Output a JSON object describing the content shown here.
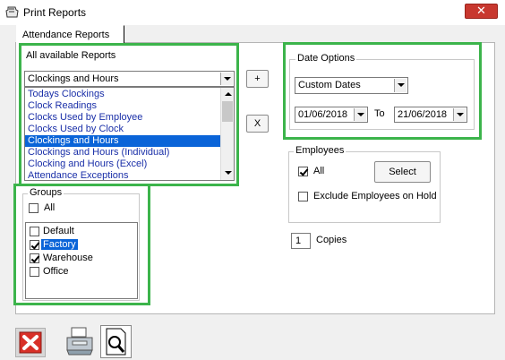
{
  "window": {
    "title": "Print Reports",
    "close_glyph": "✕"
  },
  "tabs": [
    {
      "label": "Attendance Reports"
    }
  ],
  "reports": {
    "label": "All available Reports",
    "selected": "Clockings and Hours",
    "items": [
      "Todays Clockings",
      "Clock Readings",
      "Clocks Used by Employee",
      "Clocks Used by Clock",
      "Clockings and Hours",
      "Clockings and Hours (Individual)",
      "Clocking and Hours (Excel)",
      "Attendance Exceptions"
    ],
    "selected_index": 4,
    "add_label": "+",
    "remove_label": "X"
  },
  "date_options": {
    "label": "Date Options",
    "range_type": "Custom Dates",
    "from": "01/06/2018",
    "to_label": "To",
    "to": "21/06/2018"
  },
  "employees": {
    "label": "Employees",
    "all_label": "All",
    "all_checked": true,
    "select_label": "Select",
    "exclude_label": "Exclude Employees on Hold",
    "exclude_checked": false
  },
  "copies": {
    "value": "1",
    "label": "Copies"
  },
  "groups": {
    "label": "Groups",
    "all_label": "All",
    "all_checked": false,
    "items": [
      {
        "label": "Default",
        "checked": false,
        "selected": false
      },
      {
        "label": "Factory",
        "checked": true,
        "selected": true
      },
      {
        "label": "Warehouse",
        "checked": true,
        "selected": false
      },
      {
        "label": "Office",
        "checked": false,
        "selected": false
      }
    ]
  },
  "toolbar": {
    "cancel_icon": "red-x-icon",
    "print_icon": "printer-icon",
    "preview_icon": "print-preview-icon"
  },
  "colors": {
    "highlight": "#3cb44b",
    "selection": "#0a64d8",
    "close": "#c8382f"
  }
}
